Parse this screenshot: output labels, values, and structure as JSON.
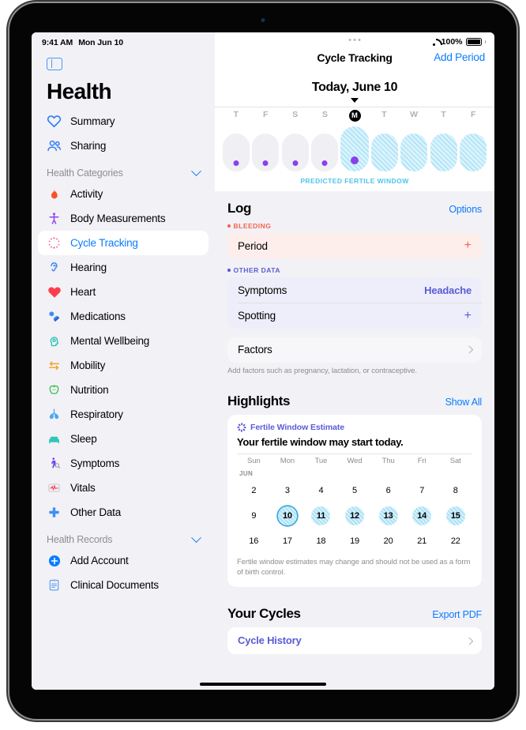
{
  "statusbar": {
    "time": "9:41 AM",
    "date": "Mon Jun 10",
    "battery": "100%"
  },
  "sidebar": {
    "app_title": "Health",
    "toggle_icon": "sidebar-toggle-icon",
    "primary": [
      {
        "label": "Summary",
        "icon": "heart-outline-icon"
      },
      {
        "label": "Sharing",
        "icon": "people-icon"
      }
    ],
    "categories_header": "Health Categories",
    "categories": [
      {
        "label": "Activity",
        "icon": "flame-icon"
      },
      {
        "label": "Body Measurements",
        "icon": "body-icon"
      },
      {
        "label": "Cycle Tracking",
        "icon": "cycle-rays-icon",
        "selected": true
      },
      {
        "label": "Hearing",
        "icon": "ear-icon"
      },
      {
        "label": "Heart",
        "icon": "heart-filled-icon"
      },
      {
        "label": "Medications",
        "icon": "pills-icon"
      },
      {
        "label": "Mental Wellbeing",
        "icon": "head-icon"
      },
      {
        "label": "Mobility",
        "icon": "arrows-icon"
      },
      {
        "label": "Nutrition",
        "icon": "apple-icon"
      },
      {
        "label": "Respiratory",
        "icon": "lungs-icon"
      },
      {
        "label": "Sleep",
        "icon": "bed-icon"
      },
      {
        "label": "Symptoms",
        "icon": "walking-magnifier-icon"
      },
      {
        "label": "Vitals",
        "icon": "waveform-icon"
      },
      {
        "label": "Other Data",
        "icon": "plus-icon"
      }
    ],
    "records_header": "Health Records",
    "records": [
      {
        "label": "Add Account",
        "icon": "plus-circle-icon"
      },
      {
        "label": "Clinical Documents",
        "icon": "clipboard-icon"
      }
    ]
  },
  "topbar": {
    "nav_title": "Cycle Tracking",
    "add_period": "Add Period",
    "more_icon": "more-dots-icon"
  },
  "today": {
    "label": "Today, June 10"
  },
  "weekstrip": {
    "days": [
      {
        "letter": "T",
        "today": false,
        "fertile": false,
        "dot": true
      },
      {
        "letter": "F",
        "today": false,
        "fertile": false,
        "dot": true
      },
      {
        "letter": "S",
        "today": false,
        "fertile": false,
        "dot": true
      },
      {
        "letter": "S",
        "today": false,
        "fertile": false,
        "dot": true
      },
      {
        "letter": "M",
        "today": true,
        "fertile": true,
        "dot": true
      },
      {
        "letter": "T",
        "today": false,
        "fertile": true,
        "dot": false
      },
      {
        "letter": "W",
        "today": false,
        "fertile": true,
        "dot": false
      },
      {
        "letter": "T",
        "today": false,
        "fertile": true,
        "dot": false
      },
      {
        "letter": "F",
        "today": false,
        "fertile": true,
        "dot": false
      }
    ],
    "caption": "PREDICTED FERTILE WINDOW"
  },
  "log": {
    "title": "Log",
    "options": "Options",
    "bleeding_label": "BLEEDING",
    "period_row": {
      "name": "Period",
      "action": "+"
    },
    "other_label": "OTHER DATA",
    "symptoms_row": {
      "name": "Symptoms",
      "value": "Headache"
    },
    "spotting_row": {
      "name": "Spotting",
      "action": "+"
    },
    "factors_row": {
      "name": "Factors"
    },
    "factors_note": "Add factors such as pregnancy, lactation, or contraceptive."
  },
  "highlights": {
    "title": "Highlights",
    "show_all": "Show All",
    "card": {
      "kicker": "Fertile Window Estimate",
      "headline": "Your fertile window may start today.",
      "dow": [
        "Sun",
        "Mon",
        "Tue",
        "Wed",
        "Thu",
        "Fri",
        "Sat"
      ],
      "month": "JUN",
      "weeks": [
        [
          {
            "d": "2"
          },
          {
            "d": "3"
          },
          {
            "d": "4"
          },
          {
            "d": "5"
          },
          {
            "d": "6"
          },
          {
            "d": "7"
          },
          {
            "d": "8"
          }
        ],
        [
          {
            "d": "9"
          },
          {
            "d": "10",
            "today": true,
            "fertile": true
          },
          {
            "d": "11",
            "fertile": true
          },
          {
            "d": "12",
            "fertile": true
          },
          {
            "d": "13",
            "fertile": true
          },
          {
            "d": "14",
            "fertile": true
          },
          {
            "d": "15",
            "fertile": true
          }
        ],
        [
          {
            "d": "16"
          },
          {
            "d": "17"
          },
          {
            "d": "18"
          },
          {
            "d": "19"
          },
          {
            "d": "20"
          },
          {
            "d": "21"
          },
          {
            "d": "22"
          }
        ]
      ],
      "footnote": "Fertile window estimates may change and should not be used as a form of birth control."
    }
  },
  "cycles": {
    "title": "Your Cycles",
    "export": "Export PDF",
    "history_row": {
      "name": "Cycle History"
    }
  },
  "colors": {
    "accent_blue": "#0a7cff",
    "purple": "#5b5bd6",
    "bleed_red": "#f5644f",
    "fertile_cyan": "#4ec4ea",
    "dot_purple": "#8a3ff0"
  }
}
